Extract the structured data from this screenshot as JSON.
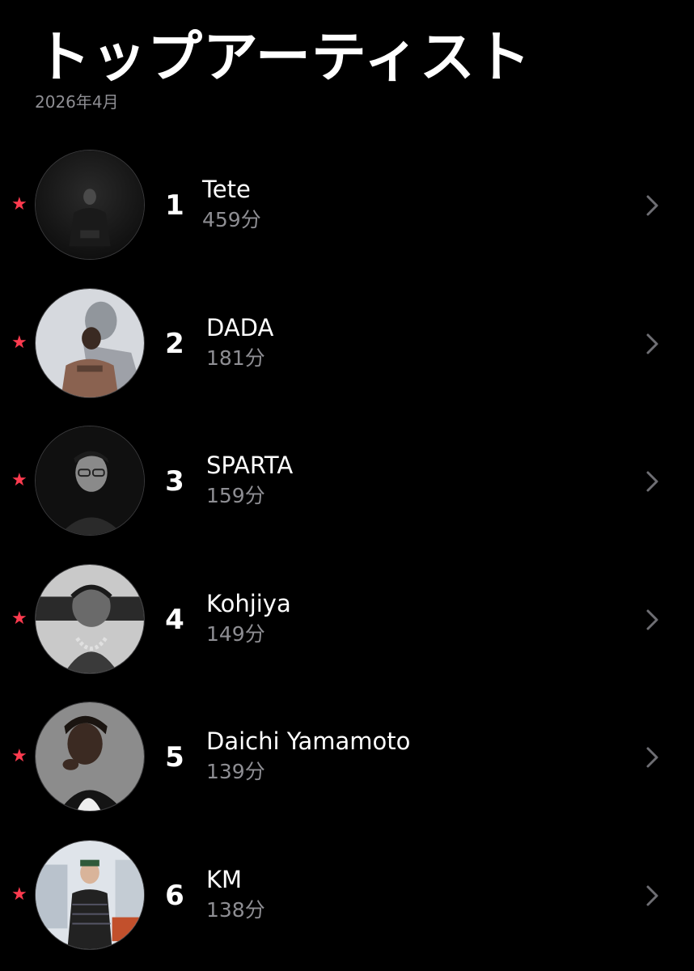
{
  "header": {
    "title": "トップアーティスト",
    "subtitle": "2026年4月"
  },
  "artists": [
    {
      "rank": "1",
      "name": "Tete",
      "minutes": "459分",
      "favorite_icon": "★"
    },
    {
      "rank": "2",
      "name": "DADA",
      "minutes": "181分",
      "favorite_icon": "★"
    },
    {
      "rank": "3",
      "name": "SPARTA",
      "minutes": "159分",
      "favorite_icon": "★"
    },
    {
      "rank": "4",
      "name": "Kohjiya",
      "minutes": "149分",
      "favorite_icon": "★"
    },
    {
      "rank": "5",
      "name": "Daichi Yamamoto",
      "minutes": "139分",
      "favorite_icon": "★"
    },
    {
      "rank": "6",
      "name": "KM",
      "minutes": "138分",
      "favorite_icon": "★"
    }
  ],
  "colors": {
    "background": "#000000",
    "star": "#ff3b4f",
    "secondary_text": "#8e8e93",
    "chevron": "#6e6e73"
  }
}
